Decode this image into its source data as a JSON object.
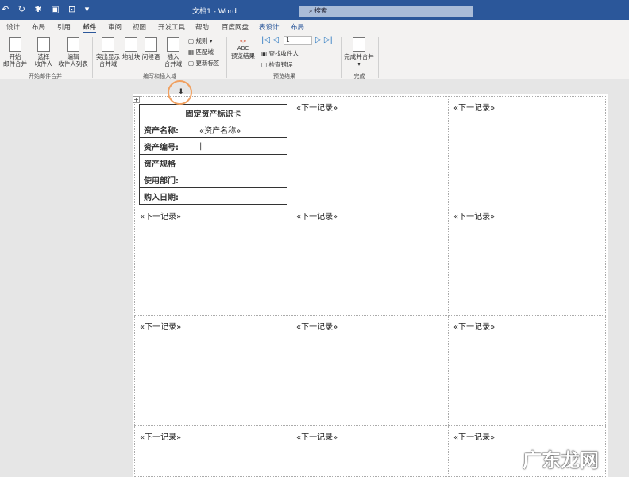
{
  "titlebar": {
    "quick_access": "↶ ↻ ✱ ▣ ⊡ ▾",
    "title": "文档1 - Word",
    "search": "搜索"
  },
  "tabs": [
    "设计",
    "布局",
    "引用",
    "邮件",
    "审阅",
    "视图",
    "开发工具",
    "帮助",
    "百度网盘",
    "表设计",
    "布局"
  ],
  "ribbon": {
    "start_merge": "开始\n邮件合并",
    "select_recipients": "选择\n收件人",
    "edit_list": "编辑\n收件人列表",
    "group1": "开始邮件合并",
    "highlight": "突出显示\n合并域",
    "address_block": "地址块",
    "greeting": "问候语",
    "insert_field": "插入\n合并域",
    "rules": "规则",
    "match_fields": "匹配域",
    "update_labels": "更新标签",
    "group2": "编写和插入域",
    "preview": "预览结果",
    "record_number": "1",
    "find_recipient": "查找收件人",
    "check_errors": "检查错误",
    "group3": "预览结果",
    "finish": "完成并合并",
    "group4": "完成"
  },
  "card": {
    "title": "固定资产标识卡",
    "rows": [
      {
        "label": "资产名称:",
        "value": "«资产名称»"
      },
      {
        "label": "资产编号:",
        "value": "|"
      },
      {
        "label": "资产规格",
        "value": ""
      },
      {
        "label": "使用部门:",
        "value": ""
      },
      {
        "label": "购入日期:",
        "value": ""
      }
    ]
  },
  "next_record": "«下一记录»",
  "watermark": "广东龙网"
}
